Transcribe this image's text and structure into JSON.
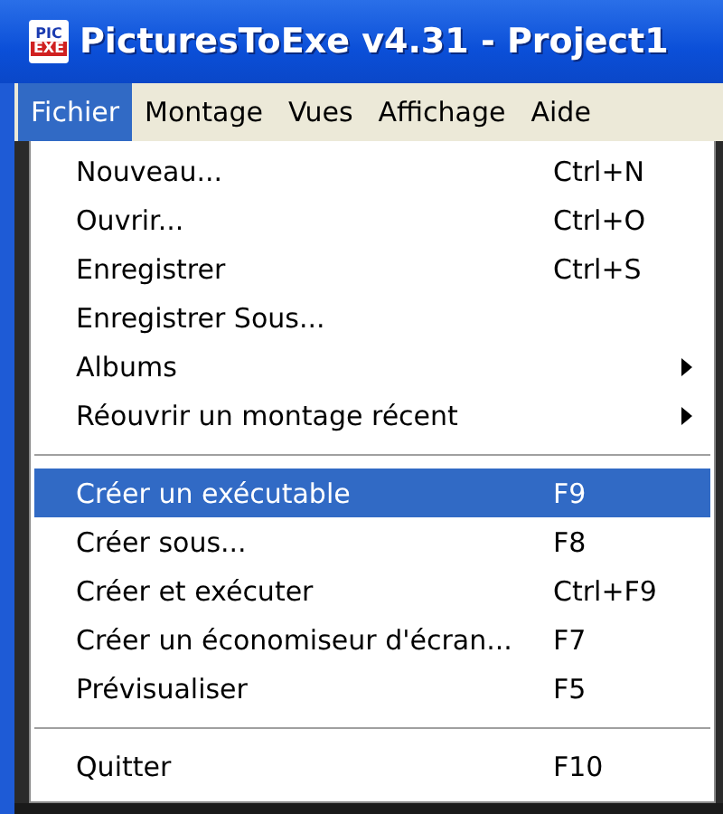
{
  "window": {
    "title": "PicturesToExe v4.31 - Project1",
    "icon_top": "PIC",
    "icon_bottom": "EXE"
  },
  "menubar": [
    {
      "label": "Fichier",
      "selected": true
    },
    {
      "label": "Montage",
      "selected": false
    },
    {
      "label": "Vues",
      "selected": false
    },
    {
      "label": "Affichage",
      "selected": false
    },
    {
      "label": "Aide",
      "selected": false
    }
  ],
  "menu": [
    {
      "kind": "item",
      "label": "Nouveau...",
      "shortcut": "Ctrl+N",
      "selected": false
    },
    {
      "kind": "item",
      "label": "Ouvrir...",
      "shortcut": "Ctrl+O",
      "selected": false
    },
    {
      "kind": "item",
      "label": "Enregistrer",
      "shortcut": "Ctrl+S",
      "selected": false
    },
    {
      "kind": "item",
      "label": "Enregistrer Sous...",
      "selected": false
    },
    {
      "kind": "submenu",
      "label": "Albums",
      "selected": false
    },
    {
      "kind": "submenu",
      "label": "Réouvrir un montage récent",
      "selected": false
    },
    {
      "kind": "separator"
    },
    {
      "kind": "item",
      "label": "Créer un exécutable",
      "shortcut": "F9",
      "selected": true
    },
    {
      "kind": "item",
      "label": "Créer sous...",
      "shortcut": "F8",
      "selected": false
    },
    {
      "kind": "item",
      "label": "Créer et exécuter",
      "shortcut": "Ctrl+F9",
      "selected": false
    },
    {
      "kind": "item",
      "label": "Créer un économiseur d'écran...",
      "shortcut": "F7",
      "selected": false
    },
    {
      "kind": "item",
      "label": "Prévisualiser",
      "shortcut": "F5",
      "selected": false
    },
    {
      "kind": "separator"
    },
    {
      "kind": "item",
      "label": "Quitter",
      "shortcut": "F10",
      "selected": false
    }
  ]
}
